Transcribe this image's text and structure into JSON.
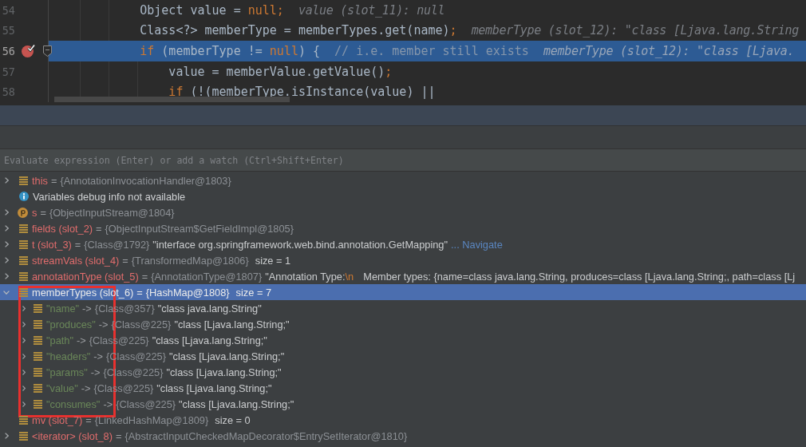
{
  "editor": {
    "lines": [
      {
        "number": "54",
        "breakpoint": false,
        "fold_marker": false,
        "current": false,
        "tokens": [
          {
            "text": "Object value = ",
            "kind": "plain"
          },
          {
            "text": "null;",
            "kind": "keyword"
          }
        ],
        "hint": "value (slot_11): null"
      },
      {
        "number": "55",
        "breakpoint": false,
        "fold_marker": false,
        "current": false,
        "tokens": [
          {
            "text": "Class<?> memberType = memberTypes.get(name)",
            "kind": "plain"
          },
          {
            "text": ";",
            "kind": "keyword"
          }
        ],
        "hint": "memberType (slot_12): \"class [Ljava.lang.String"
      },
      {
        "number": "56",
        "breakpoint": true,
        "fold_marker": true,
        "current": true,
        "tokens": [
          {
            "text": "if",
            "kind": "keyword"
          },
          {
            "text": " (memberType != ",
            "kind": "plain"
          },
          {
            "text": "null",
            "kind": "keyword"
          },
          {
            "text": ") {",
            "kind": "plain"
          },
          {
            "text": "// i.e. member still exists",
            "kind": "comment"
          }
        ],
        "hint": "memberType (slot_12): \"class [Ljava.",
        "children": [
          {
            "number": "57",
            "breakpoint": false,
            "fold_marker": false,
            "current": false,
            "tokens": [
              {
                "text": "value = memberValue.getValue()",
                "kind": "plain"
              },
              {
                "text": ";",
                "kind": "keyword"
              }
            ]
          },
          {
            "number": "58",
            "breakpoint": false,
            "fold_marker": false,
            "current": false,
            "tokens": [
              {
                "text": "if",
                "kind": "keyword"
              },
              {
                "text": " (!(memberType.isInstance(value) ||",
                "kind": "plain"
              }
            ]
          }
        ]
      }
    ]
  },
  "evaluate": {
    "placeholder": "Evaluate expression (Enter) or add a watch (Ctrl+Shift+Enter)"
  },
  "variables": [
    {
      "kind": "field",
      "name": "this",
      "sep": "=",
      "ref": "{AnnotationInvocationHandler@1803}",
      "expanded": false,
      "selected": false
    },
    {
      "kind": "info",
      "name": "Variables debug info not available",
      "selected": false
    },
    {
      "kind": "parameter",
      "name": "s",
      "sep": "=",
      "ref": "{ObjectInputStream@1804}",
      "expanded": false,
      "selected": false
    },
    {
      "kind": "field",
      "name": "fields (slot_2)",
      "sep": "=",
      "ref": "{ObjectInputStream$GetFieldImpl@1805}",
      "expanded": false,
      "selected": false
    },
    {
      "kind": "field",
      "name": "t (slot_3)",
      "sep": "=",
      "ref": "{Class@1792}",
      "value": [
        {
          "text": "\"interface org.springframework.web.bind.annotation.GetMapping\"",
          "kind": "string"
        },
        {
          "text": "... Navigate",
          "kind": "link"
        }
      ],
      "expanded": false,
      "selected": false
    },
    {
      "kind": "field",
      "name": "streamVals (slot_4)",
      "sep": "=",
      "ref": "{TransformedMap@1806}",
      "size": "size = 1",
      "expanded": false,
      "selected": false
    },
    {
      "kind": "field",
      "name": "annotationType (slot_5)",
      "sep": "=",
      "ref": "{AnnotationType@1807}",
      "value": [
        {
          "text": "\"Annotation Type:",
          "kind": "string"
        },
        {
          "text": "\\n",
          "kind": "escape"
        },
        {
          "text": "Member types: {name=class java.lang.String, produces=class [Ljava.lang.String;, path=class [Lj",
          "kind": "string"
        }
      ],
      "expanded": false,
      "selected": false
    },
    {
      "kind": "field",
      "name": "memberTypes (slot_6)",
      "sep": "=",
      "ref": "{HashMap@1808}",
      "size": "size = 7",
      "expanded": true,
      "selected": true,
      "children": [
        {
          "kind": "entry",
          "name": "\"name\"",
          "sep": "->",
          "ref": "{Class@357}",
          "value": [
            {
              "text": "\"class java.lang.String\"",
              "kind": "string"
            }
          ],
          "expanded": false,
          "selected": false
        },
        {
          "kind": "entry",
          "name": "\"produces\"",
          "sep": "->",
          "ref": "{Class@225}",
          "value": [
            {
              "text": "\"class [Ljava.lang.String;\"",
              "kind": "string"
            }
          ],
          "expanded": false,
          "selected": false
        },
        {
          "kind": "entry",
          "name": "\"path\"",
          "sep": "->",
          "ref": "{Class@225}",
          "value": [
            {
              "text": "\"class [Ljava.lang.String;\"",
              "kind": "string"
            }
          ],
          "expanded": false,
          "selected": false
        },
        {
          "kind": "entry",
          "name": "\"headers\"",
          "sep": "->",
          "ref": "{Class@225}",
          "value": [
            {
              "text": "\"class [Ljava.lang.String;\"",
              "kind": "string"
            }
          ],
          "expanded": false,
          "selected": false
        },
        {
          "kind": "entry",
          "name": "\"params\"",
          "sep": "->",
          "ref": "{Class@225}",
          "value": [
            {
              "text": "\"class [Ljava.lang.String;\"",
              "kind": "string"
            }
          ],
          "expanded": false,
          "selected": false
        },
        {
          "kind": "entry",
          "name": "\"value\"",
          "sep": "->",
          "ref": "{Class@225}",
          "value": [
            {
              "text": "\"class [Ljava.lang.String;\"",
              "kind": "string"
            }
          ],
          "expanded": false,
          "selected": false
        },
        {
          "kind": "entry",
          "name": "\"consumes\"",
          "sep": "->",
          "ref": "{Class@225}",
          "value": [
            {
              "text": "\"class [Ljava.lang.String;\"",
              "kind": "string"
            }
          ],
          "expanded": false,
          "selected": false
        }
      ]
    },
    {
      "kind": "field",
      "name": "mv (slot_7)",
      "sep": "=",
      "ref": "{LinkedHashMap@1809}",
      "size": "size = 0",
      "selected": false
    },
    {
      "kind": "field",
      "name": "<iterator> (slot_8)",
      "sep": "=",
      "ref": "{AbstractInputCheckedMapDecorator$EntrySetIterator@1810}",
      "expanded": false,
      "selected": false
    }
  ]
}
